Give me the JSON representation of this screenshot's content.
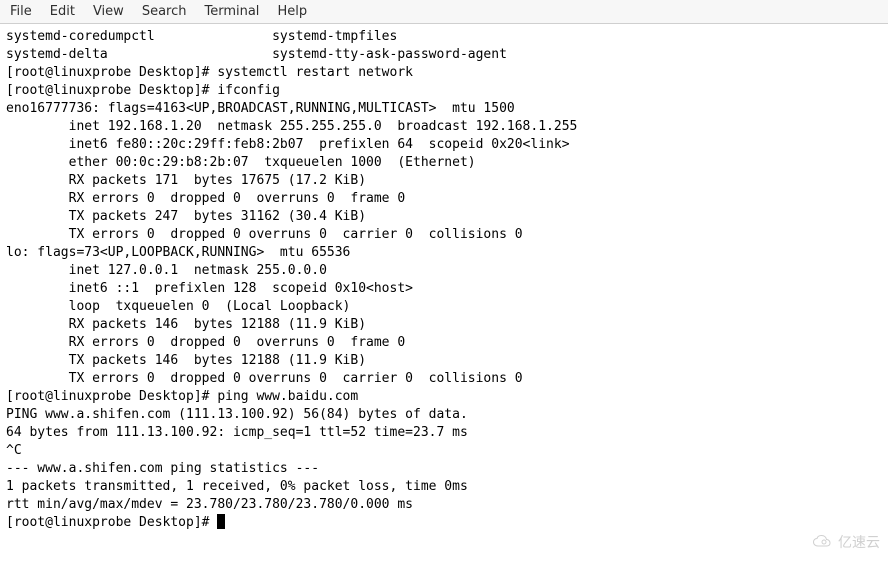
{
  "menubar": {
    "file": "File",
    "edit": "Edit",
    "view": "View",
    "search": "Search",
    "terminal": "Terminal",
    "help": "Help"
  },
  "terminal": {
    "lines": [
      "systemd-coredumpctl               systemd-tmpfiles",
      "systemd-delta                     systemd-tty-ask-password-agent",
      "[root@linuxprobe Desktop]# systemctl restart network",
      "[root@linuxprobe Desktop]# ifconfig",
      "eno16777736: flags=4163<UP,BROADCAST,RUNNING,MULTICAST>  mtu 1500",
      "        inet 192.168.1.20  netmask 255.255.255.0  broadcast 192.168.1.255",
      "        inet6 fe80::20c:29ff:feb8:2b07  prefixlen 64  scopeid 0x20<link>",
      "        ether 00:0c:29:b8:2b:07  txqueuelen 1000  (Ethernet)",
      "        RX packets 171  bytes 17675 (17.2 KiB)",
      "        RX errors 0  dropped 0  overruns 0  frame 0",
      "        TX packets 247  bytes 31162 (30.4 KiB)",
      "        TX errors 0  dropped 0 overruns 0  carrier 0  collisions 0",
      "",
      "lo: flags=73<UP,LOOPBACK,RUNNING>  mtu 65536",
      "        inet 127.0.0.1  netmask 255.0.0.0",
      "        inet6 ::1  prefixlen 128  scopeid 0x10<host>",
      "        loop  txqueuelen 0  (Local Loopback)",
      "        RX packets 146  bytes 12188 (11.9 KiB)",
      "        RX errors 0  dropped 0  overruns 0  frame 0",
      "        TX packets 146  bytes 12188 (11.9 KiB)",
      "        TX errors 0  dropped 0 overruns 0  carrier 0  collisions 0",
      "",
      "[root@linuxprobe Desktop]# ping www.baidu.com",
      "PING www.a.shifen.com (111.13.100.92) 56(84) bytes of data.",
      "64 bytes from 111.13.100.92: icmp_seq=1 ttl=52 time=23.7 ms",
      "^C",
      "--- www.a.shifen.com ping statistics ---",
      "1 packets transmitted, 1 received, 0% packet loss, time 0ms",
      "rtt min/avg/max/mdev = 23.780/23.780/23.780/0.000 ms"
    ],
    "prompt": "[root@linuxprobe Desktop]# "
  },
  "watermark": {
    "text": "亿速云"
  }
}
